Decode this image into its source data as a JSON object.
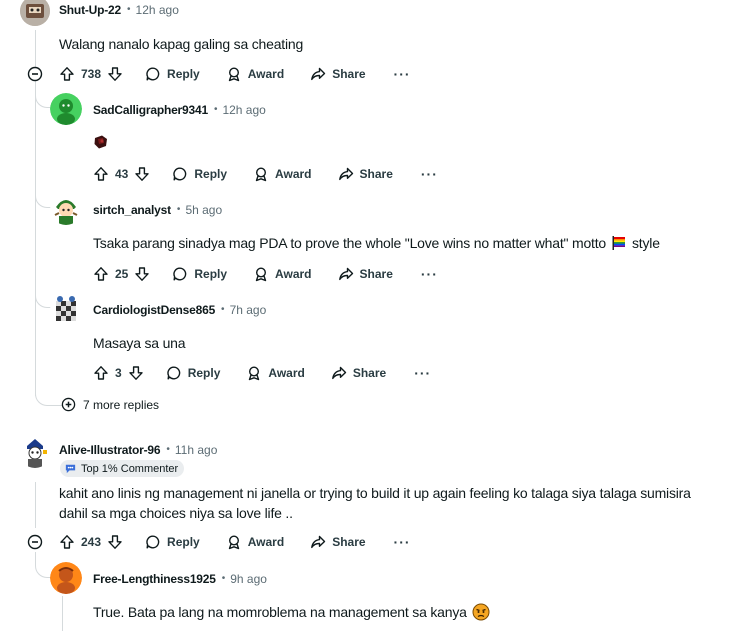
{
  "comments": [
    {
      "author": "Shut-Up-22",
      "time": "12h ago",
      "text": "Walang nanalo kapag galing sa cheating",
      "votes": "738",
      "actions": {
        "reply": "Reply",
        "award": "Award",
        "share": "Share"
      }
    },
    {
      "author": "SadCalligrapher9341",
      "time": "12h ago",
      "text": "",
      "votes": "43",
      "actions": {
        "reply": "Reply",
        "award": "Award",
        "share": "Share"
      }
    },
    {
      "author": "sirtch_analyst",
      "time": "5h ago",
      "text": "Tsaka parang sinadya mag PDA to prove the whole \"Love wins no matter what\" motto",
      "text_suffix": "style",
      "votes": "25",
      "actions": {
        "reply": "Reply",
        "award": "Award",
        "share": "Share"
      }
    },
    {
      "author": "CardiologistDense865",
      "time": "7h ago",
      "text": "Masaya sa una",
      "votes": "3",
      "actions": {
        "reply": "Reply",
        "award": "Award",
        "share": "Share"
      }
    },
    {
      "author": "Alive-Illustrator-96",
      "time": "11h ago",
      "badge": "Top 1% Commenter",
      "text_line1": "kahit ano linis ng management ni janella or trying to build it up again feeling ko talaga siya talaga sumisira",
      "text_line2": "dahil sa mga choices niya sa love life ..",
      "votes": "243",
      "actions": {
        "reply": "Reply",
        "award": "Award",
        "share": "Share"
      }
    },
    {
      "author": "Free-Lengthiness1925",
      "time": "9h ago",
      "text": "True. Bata pa lang na momroblema na management sa kanya"
    }
  ],
  "more_replies": "7 more replies",
  "colors": {
    "text": "#0f1a1c",
    "muted": "#5c6c74",
    "line": "#d5dadc",
    "badge_bg": "#eaedef"
  },
  "icons": [
    "upvote-icon",
    "downvote-icon",
    "reply-bubble-icon",
    "award-icon",
    "share-arrow-icon",
    "more-dots-icon",
    "collapse-minus-icon",
    "expand-plus-icon",
    "flag-emoji-icon",
    "pouting-emoji-icon"
  ]
}
